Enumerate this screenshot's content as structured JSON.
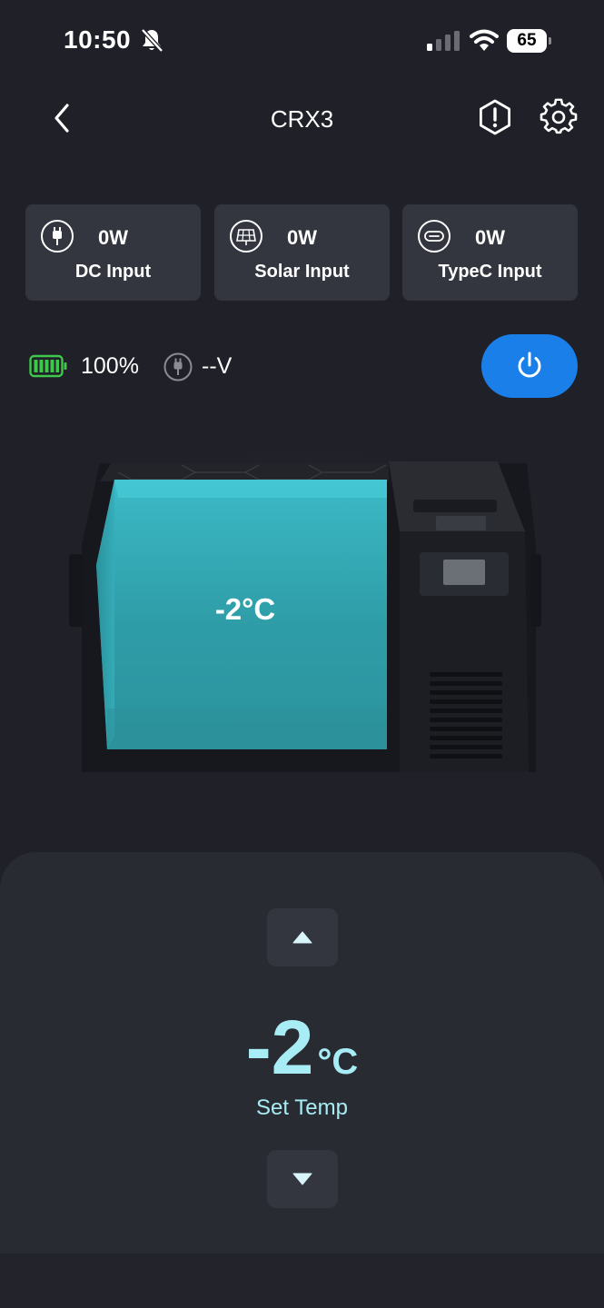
{
  "status_bar": {
    "time": "10:50",
    "battery_level": "65"
  },
  "header": {
    "title": "CRX3"
  },
  "inputs": [
    {
      "watts": "0W",
      "label": "DC Input",
      "icon": "plug-icon"
    },
    {
      "watts": "0W",
      "label": "Solar Input",
      "icon": "solar-panel-icon"
    },
    {
      "watts": "0W",
      "label": "TypeC Input",
      "icon": "usb-c-icon"
    }
  ],
  "battery": {
    "percent": "100%",
    "voltage": "--V"
  },
  "fridge": {
    "current_temp": "-2°C"
  },
  "control": {
    "set_value": "-2",
    "unit": "°C",
    "label": "Set Temp"
  },
  "colors": {
    "background": "#1f2028",
    "card": "#33353f",
    "accent_blue": "#1b7fe9",
    "temp_cyan": "#a8ecf5",
    "battery_green": "#3ec74a"
  }
}
